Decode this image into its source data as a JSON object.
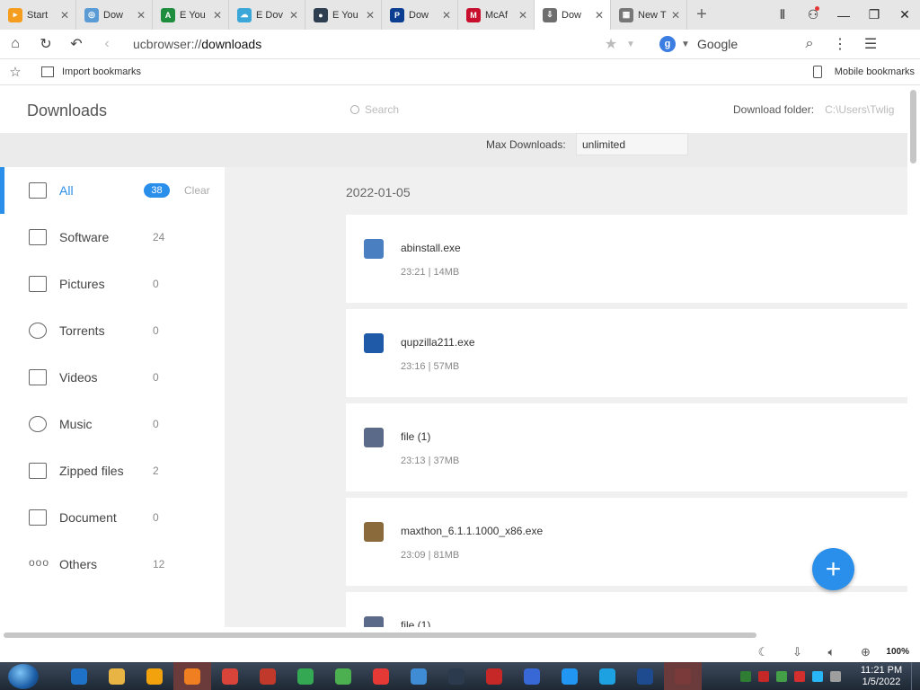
{
  "tabs": [
    {
      "title": "Start",
      "icon": "start-page-icon",
      "color": "#f59d1f",
      "glyph": "▸"
    },
    {
      "title": "Dow",
      "icon": "globe-icon",
      "color": "#5b9bd5",
      "glyph": "◎"
    },
    {
      "title": "E You",
      "icon": "avatar-icon",
      "color": "#1e8e3e",
      "glyph": "A"
    },
    {
      "title": "E Dov",
      "icon": "cloud-icon",
      "color": "#3aa7d8",
      "glyph": "☁"
    },
    {
      "title": "E You",
      "icon": "user-icon",
      "color": "#2d3e50",
      "glyph": "●"
    },
    {
      "title": "Dow",
      "icon": "app-icon",
      "color": "#0b3d91",
      "glyph": "P"
    },
    {
      "title": "McAf",
      "icon": "mcafee-icon",
      "color": "#c8102e",
      "glyph": "M"
    },
    {
      "title": "Dow",
      "icon": "download-icon",
      "color": "#6e6e6e",
      "glyph": "⇩",
      "active": true
    },
    {
      "title": "New T",
      "icon": "newtab-icon",
      "color": "#777777",
      "glyph": "▦"
    }
  ],
  "address": {
    "scheme": "ucbrowser://",
    "path": "downloads",
    "search_engine": "Google",
    "engine_glyph": "g"
  },
  "bookmarks": {
    "import_label": "Import bookmarks",
    "mobile_label": "Mobile bookmarks"
  },
  "downloads_page": {
    "title": "Downloads",
    "search_placeholder": "Search",
    "folder_label": "Download folder:",
    "folder_path": "C:\\Users\\Twlig",
    "max_label": "Max Downloads:",
    "max_value": "unlimited"
  },
  "categories": [
    {
      "label": "All",
      "count": "38",
      "icon": "inbox-icon",
      "active": true,
      "clear_label": "Clear"
    },
    {
      "label": "Software",
      "count": "24",
      "icon": "window-icon"
    },
    {
      "label": "Pictures",
      "count": "0",
      "icon": "image-icon"
    },
    {
      "label": "Torrents",
      "count": "0",
      "icon": "torrent-icon"
    },
    {
      "label": "Videos",
      "count": "0",
      "icon": "video-icon"
    },
    {
      "label": "Music",
      "count": "0",
      "icon": "headphones-icon"
    },
    {
      "label": "Zipped files",
      "count": "2",
      "icon": "zip-icon"
    },
    {
      "label": "Document",
      "count": "0",
      "icon": "folder-icon"
    },
    {
      "label": "Others",
      "count": "12",
      "icon": "more-icon"
    }
  ],
  "date_group": "2022-01-05",
  "downloads": [
    {
      "name": "abinstall.exe",
      "time": "23:21",
      "size": "14MB",
      "icon": "installer-icon",
      "color": "#4a7fc1"
    },
    {
      "name": "qupzilla211.exe",
      "time": "23:16",
      "size": "57MB",
      "icon": "qupzilla-icon",
      "color": "#1e5aa8"
    },
    {
      "name": "file (1)",
      "time": "23:13",
      "size": "37MB",
      "icon": "file-icon",
      "color": "#5a6a88"
    },
    {
      "name": "maxthon_6.1.1.1000_x86.exe",
      "time": "23:09",
      "size": "81MB",
      "icon": "maxthon-icon",
      "color": "#8a6a3a"
    },
    {
      "name": "file (1)",
      "time": "",
      "size": "",
      "icon": "file-icon",
      "color": "#5a6a88"
    }
  ],
  "status": {
    "zoom": "100%"
  },
  "taskbar": {
    "apps": [
      {
        "icon": "ie-icon",
        "color": "#1e73c8"
      },
      {
        "icon": "explorer-icon",
        "color": "#e8b545"
      },
      {
        "icon": "media-icon",
        "color": "#f2a20c"
      },
      {
        "icon": "uc-browser-icon",
        "color": "#f07f22",
        "highlight": true
      },
      {
        "icon": "chrome-like-icon",
        "color": "#d8443a"
      },
      {
        "icon": "colors-icon",
        "color": "#c0392b"
      },
      {
        "icon": "chrome-icon",
        "color": "#34a853"
      },
      {
        "icon": "leaf-icon",
        "color": "#4caf50"
      },
      {
        "icon": "a-icon",
        "color": "#e53935"
      },
      {
        "icon": "globe-icon",
        "color": "#3f8bd4"
      },
      {
        "icon": "blank-icon",
        "color": "#2b3a4c"
      },
      {
        "icon": "vivaldi-icon",
        "color": "#c62828"
      },
      {
        "icon": "orb-icon",
        "color": "#3867d6"
      },
      {
        "icon": "n-icon",
        "color": "#2196f3"
      },
      {
        "icon": "q-icon",
        "color": "#1da1e0"
      },
      {
        "icon": "maxthon-icon",
        "color": "#1e4b8f"
      },
      {
        "icon": "cursor-icon",
        "color": "#7a3a3a",
        "highlight": true
      }
    ],
    "time": "11:21 PM",
    "date": "1/5/2022"
  }
}
